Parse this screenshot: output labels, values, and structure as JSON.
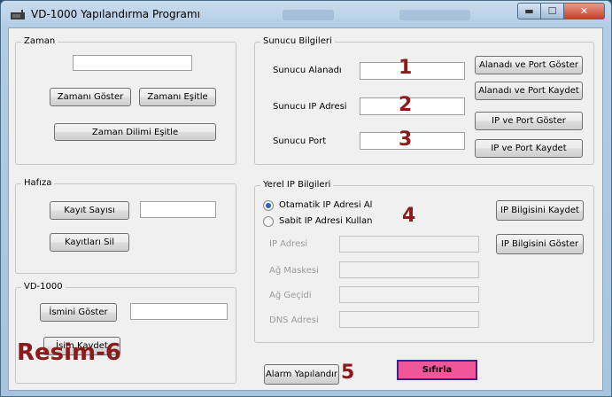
{
  "window": {
    "title": "VD-1000 Yapılandırma Programı",
    "controls": {
      "minimize": "▬",
      "maximize": "☐",
      "close": "✕"
    }
  },
  "zaman": {
    "legend": "Zaman",
    "time_value": "",
    "show_button": "Zamanı Göster",
    "sync_button": "Zamanı Eşitle",
    "timezone_button": "Zaman Dilimi Eşitle"
  },
  "hafiza": {
    "legend": "Hafıza",
    "count_button": "Kayıt Sayısı",
    "count_value": "",
    "delete_button": "Kayıtları Sil"
  },
  "vd1000": {
    "legend": "VD-1000",
    "show_name_button": "İsmini Göster",
    "name_value": "",
    "save_name_button": "İsim Kaydet"
  },
  "sunucu": {
    "legend": "Sunucu Bilgileri",
    "domain_label": "Sunucu Alanadı",
    "domain_value": "",
    "ip_label": "Sunucu IP Adresi",
    "ip_value": "",
    "port_label": "Sunucu Port",
    "port_value": "",
    "btn_domain_show": "Alanadı ve Port Göster",
    "btn_domain_save": "Alanadı ve Port Kaydet",
    "btn_ip_show": "IP ve Port Göster",
    "btn_ip_save": "IP ve Port Kaydet"
  },
  "yerel": {
    "legend": "Yerel IP Bilgileri",
    "radio_auto": "Otamatik IP Adresi Al",
    "radio_static": "Sabit IP Adresi Kullan",
    "selected": "auto",
    "ip_label": "IP Adresi",
    "mask_label": "Ağ Maskesi",
    "gateway_label": "Ağ Geçidi",
    "dns_label": "DNS Adresi",
    "btn_save": "IP Bilgisini Kaydet",
    "btn_show": "IP Bilgisini Göster"
  },
  "bottom": {
    "alarm_button": "Alarm Yapılandır",
    "reset_button": "Sıfırla"
  },
  "annotations": {
    "n1": "1",
    "n2": "2",
    "n3": "3",
    "n4": "4",
    "n5": "5",
    "caption": "Resim-6"
  }
}
